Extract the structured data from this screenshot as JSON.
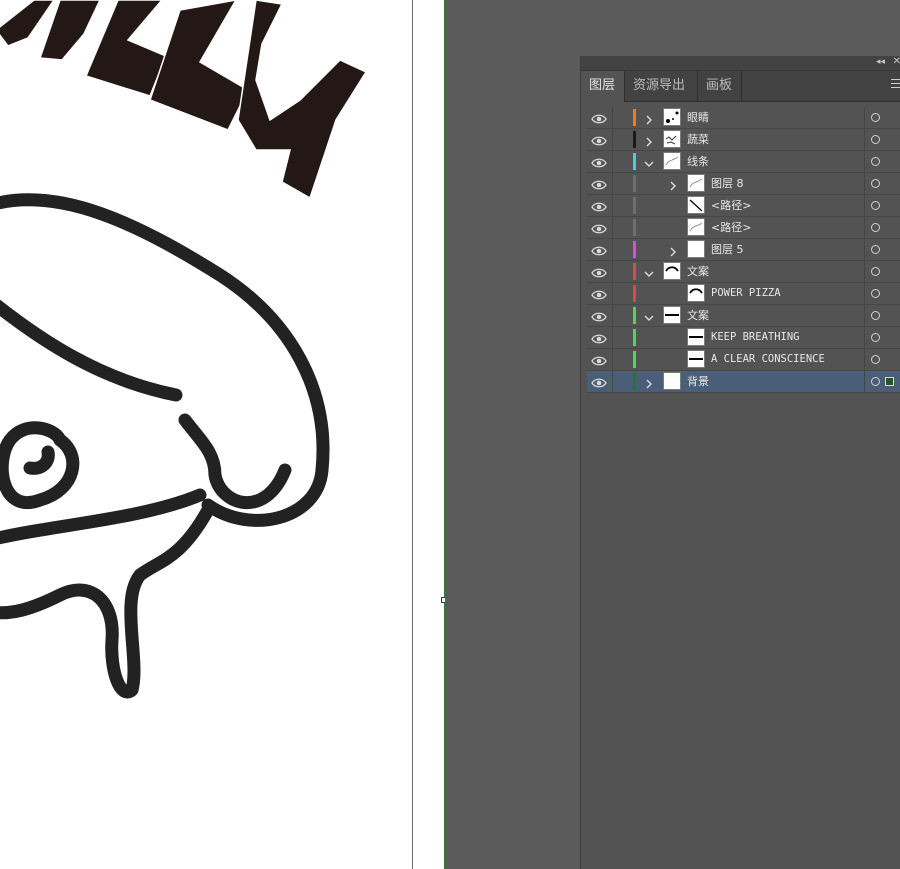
{
  "panel": {
    "tabs": [
      {
        "label": "图层",
        "active": true
      },
      {
        "label": "资源导出",
        "active": false
      },
      {
        "label": "画板",
        "active": false
      }
    ],
    "collapse_icon": "double-chevron-left-icon",
    "close_icon": "close-icon",
    "menu_icon": "panel-menu-icon"
  },
  "layers": [
    {
      "name": "眼睛",
      "color": "#f07a1a",
      "indent": 0,
      "expander": "collapsed",
      "thumb": "dots",
      "selected": false
    },
    {
      "name": "蔬菜",
      "color": "#1a1a1a",
      "indent": 0,
      "expander": "collapsed",
      "thumb": "veg",
      "selected": false
    },
    {
      "name": "线条",
      "color": "#3fd3e0",
      "indent": 0,
      "expander": "expanded",
      "thumb": "lines",
      "selected": false
    },
    {
      "name": "图层 8",
      "color": "#6e6e6e",
      "indent": 1,
      "expander": "collapsed",
      "thumb": "lines",
      "selected": false
    },
    {
      "name": "<路径>",
      "color": "#6e6e6e",
      "indent": 1,
      "expander": "none",
      "thumb": "path",
      "selected": false
    },
    {
      "name": "<路径>",
      "color": "#6e6e6e",
      "indent": 1,
      "expander": "none",
      "thumb": "lines",
      "selected": false
    },
    {
      "name": "图层 5",
      "color": "#d64fe0",
      "indent": 1,
      "expander": "collapsed",
      "thumb": "blank",
      "selected": false
    },
    {
      "name": "文案",
      "color": "#e04848",
      "indent": 0,
      "expander": "expanded",
      "thumb": "arc",
      "selected": false
    },
    {
      "name": "POWER PIZZA",
      "color": "#e04848",
      "indent": 1,
      "expander": "none",
      "thumb": "arc",
      "selected": false
    },
    {
      "name": "文案",
      "color": "#4fd84f",
      "indent": 0,
      "expander": "expanded",
      "thumb": "text",
      "selected": false
    },
    {
      "name": "KEEP BREATHING",
      "color": "#4fd84f",
      "indent": 1,
      "expander": "none",
      "thumb": "text",
      "selected": false
    },
    {
      "name": "A CLEAR CONSCIENCE",
      "color": "#4fd84f",
      "indent": 1,
      "expander": "none",
      "thumb": "text",
      "selected": false
    },
    {
      "name": "背景",
      "color": "#1f7a2a",
      "indent": 0,
      "expander": "collapsed",
      "thumb": "blank",
      "selected": true
    }
  ]
}
